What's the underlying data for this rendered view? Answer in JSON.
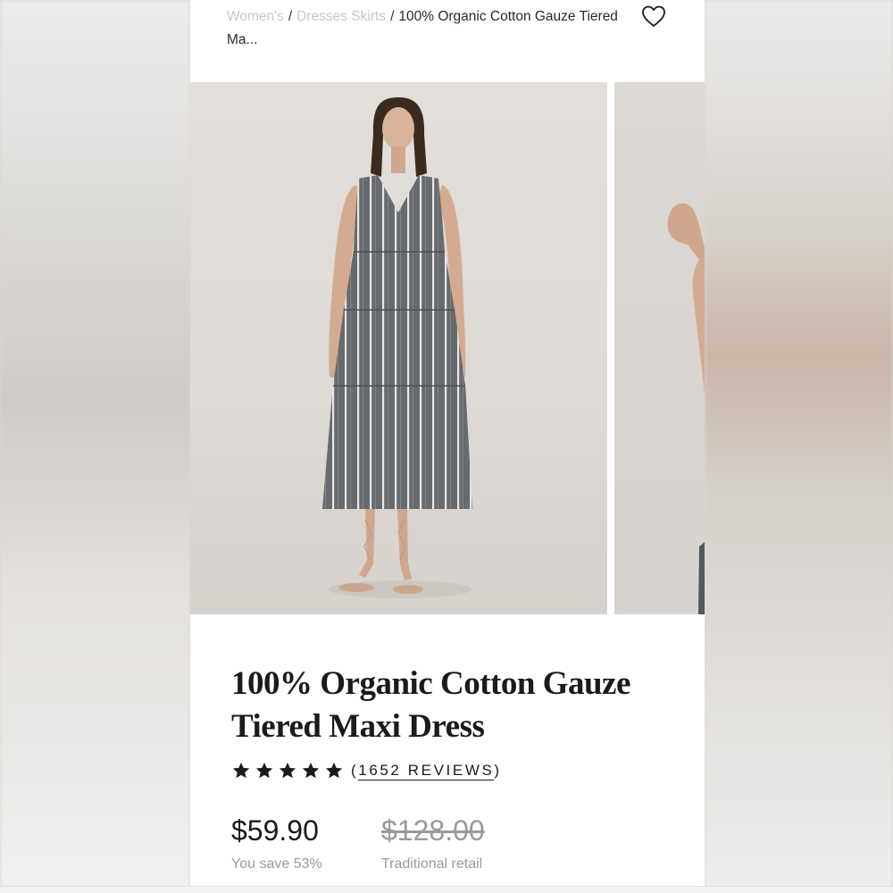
{
  "breadcrumb": {
    "items": [
      "Women's",
      "Dresses Skirts"
    ],
    "separator": "/",
    "current": "100% Organic Cotton Gauze Tiered Ma..."
  },
  "icons": {
    "wishlist": "heart-icon",
    "rating_star": "star-icon"
  },
  "gallery": {
    "images": [
      "product-photo-front",
      "product-photo-side"
    ]
  },
  "product": {
    "title_line1": "100% Organic Cotton Gauze",
    "title_line2": "Tiered Maxi Dress",
    "rating_stars": 5,
    "reviews_open": "(",
    "reviews_text": "1652 REVIEWS",
    "reviews_close": ")",
    "price": "$59.90",
    "retail_price": "$128.00",
    "savings": "You save 53%",
    "retail_label": "Traditional retail"
  },
  "colors": {
    "text": "#1b1b1b",
    "muted": "#9a9a9a",
    "crumb_link": "#c8c8c8",
    "dress": "#6a6c70"
  }
}
